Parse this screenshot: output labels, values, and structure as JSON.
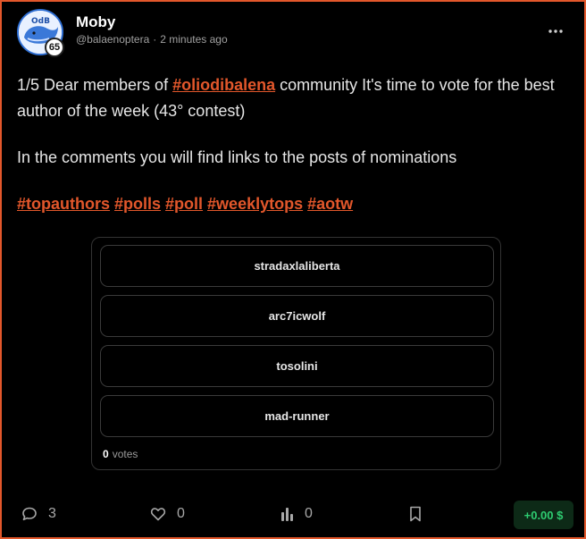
{
  "author": {
    "name": "Moby",
    "handle": "@balaenoptera",
    "separator": "·",
    "time": "2 minutes ago",
    "reputation": "65"
  },
  "post": {
    "line1_prefix": "1/5 Dear members of ",
    "community_tag": "#oliodibalena",
    "line1_suffix": " community It's time to vote for the best author of the week (43° contest)",
    "line2": "In the comments you will find links to the posts of nominations",
    "tags": [
      "#topauthors",
      "#polls",
      "#poll",
      "#weeklytops",
      "#aotw"
    ]
  },
  "poll": {
    "options": [
      "stradaxlaliberta",
      "arc7icwolf",
      "tosolini",
      "mad-runner"
    ],
    "vote_count": "0",
    "votes_label": "votes"
  },
  "actions": {
    "comments": "3",
    "likes": "0",
    "stats": "0",
    "payout": "+0.00 $"
  },
  "colors": {
    "accent": "#e2572b",
    "payout_green": "#2ecc71"
  },
  "icons": [
    "more-icon",
    "comment-icon",
    "heart-icon",
    "bar-chart-icon",
    "bookmark-icon"
  ]
}
